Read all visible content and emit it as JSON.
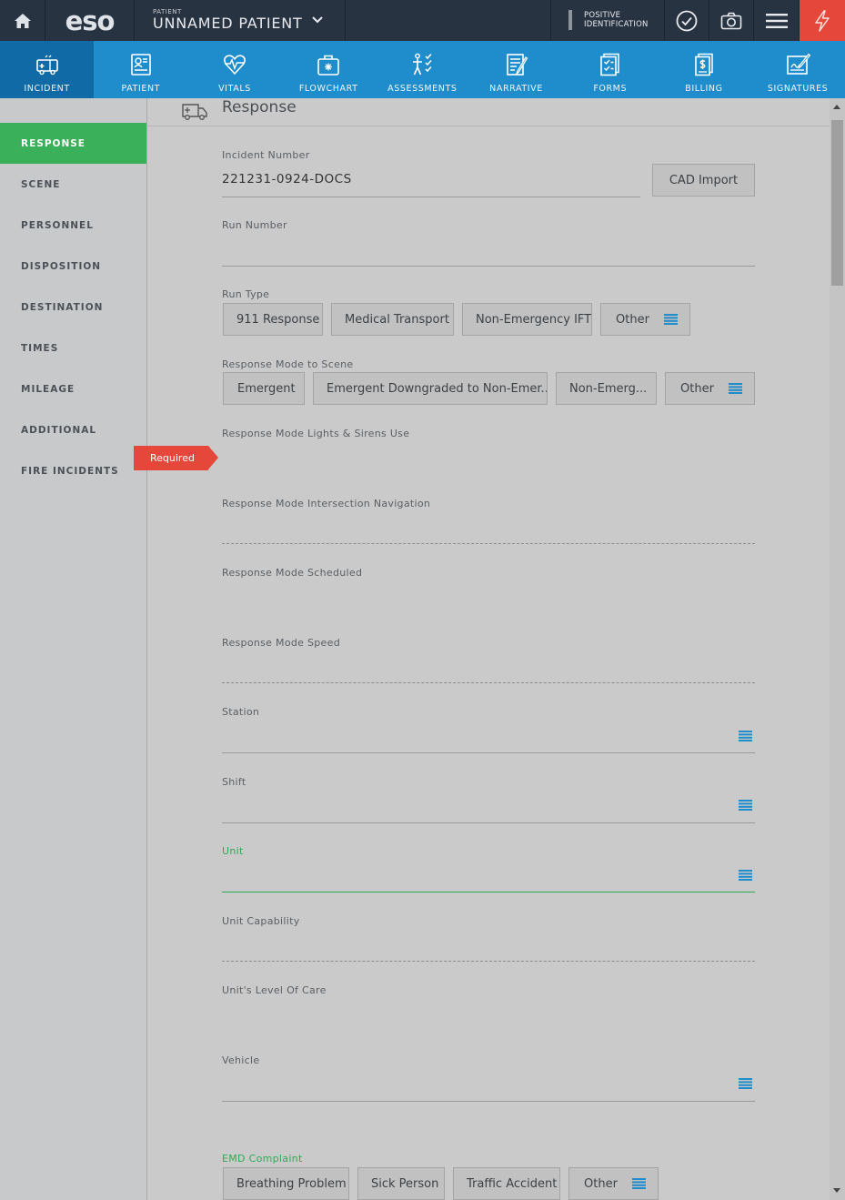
{
  "topbar": {
    "logo": "eso",
    "patient_caption": "PATIENT",
    "patient_name": "UNNAMED PATIENT",
    "positive_id_line1": "POSITIVE",
    "positive_id_line2": "IDENTIFICATION",
    "icons": [
      "home-icon",
      "chevron-down-icon",
      "check-circle-icon",
      "camera-icon",
      "hamburger-menu-icon",
      "lightning-icon"
    ]
  },
  "nav": {
    "items": [
      {
        "label": "INCIDENT",
        "icon": "ambulance-icon",
        "active": true
      },
      {
        "label": "PATIENT",
        "icon": "patient-card-icon"
      },
      {
        "label": "VITALS",
        "icon": "heartbeat-icon"
      },
      {
        "label": "FLOWCHART",
        "icon": "medkit-icon"
      },
      {
        "label": "ASSESSMENTS",
        "icon": "body-check-icon"
      },
      {
        "label": "NARRATIVE",
        "icon": "narrative-pen-icon"
      },
      {
        "label": "FORMS",
        "icon": "forms-check-icon"
      },
      {
        "label": "BILLING",
        "icon": "billing-dollar-icon"
      },
      {
        "label": "SIGNATURES",
        "icon": "signature-icon"
      }
    ]
  },
  "sidebar": {
    "items": [
      {
        "label": "RESPONSE",
        "active": true
      },
      {
        "label": "SCENE"
      },
      {
        "label": "PERSONNEL"
      },
      {
        "label": "DISPOSITION"
      },
      {
        "label": "DESTINATION"
      },
      {
        "label": "TIMES"
      },
      {
        "label": "MILEAGE"
      },
      {
        "label": "ADDITIONAL"
      },
      {
        "label": "FIRE INCIDENTS"
      }
    ]
  },
  "required_flag": "Required",
  "section": {
    "title": "Response"
  },
  "form": {
    "incident_number": {
      "label": "Incident Number",
      "value": "221231-0924-DOCS"
    },
    "cad_import": "CAD Import",
    "run_number": {
      "label": "Run Number",
      "value": ""
    },
    "run_type": {
      "label": "Run Type",
      "options": [
        "911 Response",
        "Medical Transport",
        "Non-Emergency IFT",
        "Other"
      ]
    },
    "response_mode": {
      "label": "Response Mode to Scene",
      "options": [
        "Emergent",
        "Emergent Downgraded to Non-Emer...",
        "Non-Emerg...",
        "Other"
      ]
    },
    "lights_sirens": {
      "label": "Response Mode Lights & Sirens Use"
    },
    "intersection": {
      "label": "Response Mode Intersection Navigation"
    },
    "scheduled": {
      "label": "Response Mode Scheduled"
    },
    "speed": {
      "label": "Response Mode Speed"
    },
    "station": {
      "label": "Station"
    },
    "shift": {
      "label": "Shift"
    },
    "unit": {
      "label": "Unit"
    },
    "unit_capability": {
      "label": "Unit Capability"
    },
    "level_of_care": {
      "label": "Unit's Level Of Care"
    },
    "vehicle": {
      "label": "Vehicle"
    },
    "emd_complaint": {
      "label": "EMD Complaint",
      "options": [
        "Breathing Problem",
        "Sick Person",
        "Traffic Accident",
        "Other"
      ]
    }
  },
  "colors": {
    "topbar": "#283342",
    "nav": "#1f8ccb",
    "nav_active": "#0f6aa6",
    "sidebar_active": "#3bb05a",
    "required": "#e5473a",
    "accent_green": "#2eaa55",
    "list_icon": "#1f8ccb"
  }
}
